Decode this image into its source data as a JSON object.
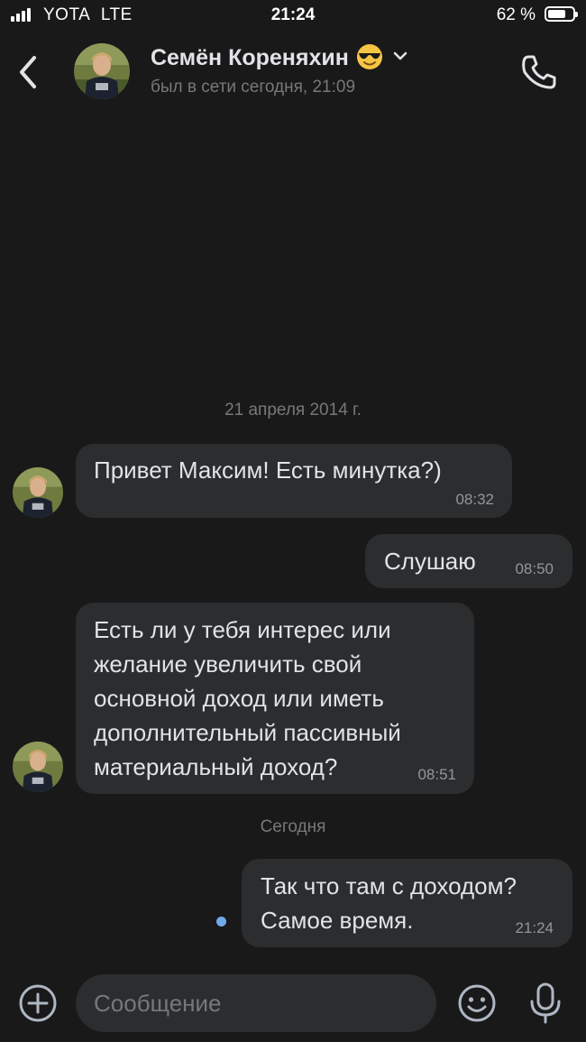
{
  "status_bar": {
    "carrier": "YOTA",
    "network": "LTE",
    "time": "21:24",
    "battery_text": "62 %",
    "battery_level": 0.62,
    "signal_bars": 4
  },
  "header": {
    "contact_name": "Семён Кореняхин",
    "status": "был в сети сегодня, 21:09"
  },
  "chat": {
    "date_separator_1": "21 апреля 2014 г.",
    "date_separator_2": "Сегодня",
    "messages": [
      {
        "direction": "incoming",
        "text": "Привет Максим! Есть минутка?)",
        "time": "08:32"
      },
      {
        "direction": "outgoing",
        "text": "Слушаю",
        "time": "08:50"
      },
      {
        "direction": "incoming",
        "text": "Есть ли у тебя интерес или\nжелание увеличить свой\nосновной доход или иметь\nдополнительный пассивный\nматериальный доход?",
        "time": "08:51"
      },
      {
        "direction": "outgoing",
        "text": "Так что там с доходом?\nСамое время.",
        "time": "21:24",
        "unread": true
      }
    ]
  },
  "input": {
    "placeholder": "Сообщение"
  },
  "icons": {
    "back": "chevron-left-icon",
    "call": "phone-icon",
    "add": "plus-circle-icon",
    "emoji": "smile-icon",
    "mic": "microphone-icon",
    "name_emoji": "sunglasses-emoji",
    "dropdown": "chevron-down-icon"
  },
  "colors": {
    "background": "#19191a",
    "bubble": "#2c2d2e",
    "text": "#e1e3e6",
    "secondary_text": "#76787a",
    "unread_dot": "#71aaeb"
  }
}
